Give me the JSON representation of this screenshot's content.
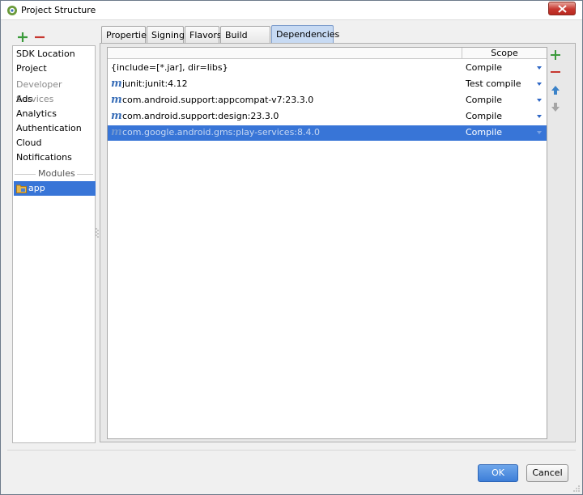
{
  "window": {
    "title": "Project Structure"
  },
  "left_toolbar": {
    "add_icon": "plus-icon",
    "remove_icon": "minus-icon"
  },
  "left_list": {
    "items": [
      {
        "label": "SDK Location"
      },
      {
        "label": "Project"
      },
      {
        "label": "Developer Services",
        "header": true
      },
      {
        "label": "Ads"
      },
      {
        "label": "Analytics"
      },
      {
        "label": "Authentication"
      },
      {
        "label": "Cloud"
      },
      {
        "label": "Notifications"
      }
    ],
    "modules_label": "Modules",
    "module": {
      "label": "app"
    }
  },
  "tabs": [
    "Properties",
    "Signing",
    "Flavors",
    "Build Types",
    "Dependencies"
  ],
  "active_tab": "Dependencies",
  "dependencies": {
    "header_scope": "Scope",
    "rows": [
      {
        "name": "{include=[*.jar], dir=libs}",
        "scope": "Compile",
        "maven_icon": false
      },
      {
        "name": "junit:junit:4.12",
        "scope": "Test compile",
        "maven_icon": true
      },
      {
        "name": "com.android.support:appcompat-v7:23.3.0",
        "scope": "Compile",
        "maven_icon": true
      },
      {
        "name": "com.android.support:design:23.3.0",
        "scope": "Compile",
        "maven_icon": true
      },
      {
        "name": "com.google.android.gms:play-services:8.4.0",
        "scope": "Compile",
        "maven_icon": true,
        "selected": true
      }
    ],
    "maven_glyph": "m"
  },
  "buttons": {
    "ok": "OK",
    "cancel": "Cancel"
  },
  "colors": {
    "selection": "#3875d7",
    "add_green": "#3a9a3a",
    "remove_red": "#c7372f",
    "ok_blue": "#3d7ed8"
  }
}
